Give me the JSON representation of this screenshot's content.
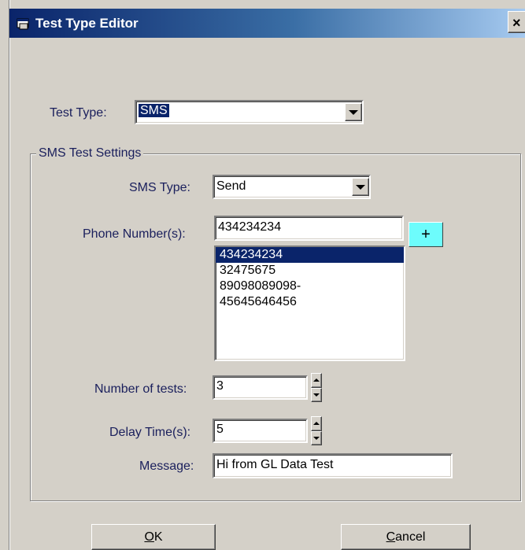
{
  "window": {
    "title": "Test Type Editor",
    "close_glyph": "×"
  },
  "test_type": {
    "label": "Test Type:",
    "value": "SMS"
  },
  "sms_group": {
    "title": "SMS Test Settings",
    "sms_type": {
      "label": "SMS Type:",
      "value": "Send"
    },
    "phone": {
      "label": "Phone Number(s):",
      "value": "434234234",
      "add_label": "+",
      "list": [
        "434234234",
        "32475675",
        "89098089098-",
        "45645646456"
      ],
      "selected_index": 0
    },
    "num_tests": {
      "label": "Number of tests:",
      "value": "3"
    },
    "delay": {
      "label": "Delay Time(s):",
      "value": "5"
    },
    "message": {
      "label": "Message:",
      "value": "Hi from GL Data Test"
    }
  },
  "buttons": {
    "ok_mnemonic": "O",
    "ok_rest": "K",
    "cancel_mnemonic": "C",
    "cancel_rest": "ancel"
  },
  "colors": {
    "face": "#d4d0c8",
    "title_start": "#0a246a",
    "selection": "#0a246a",
    "label_text": "#1a1f5c",
    "add_button": "#6dfcfc"
  }
}
